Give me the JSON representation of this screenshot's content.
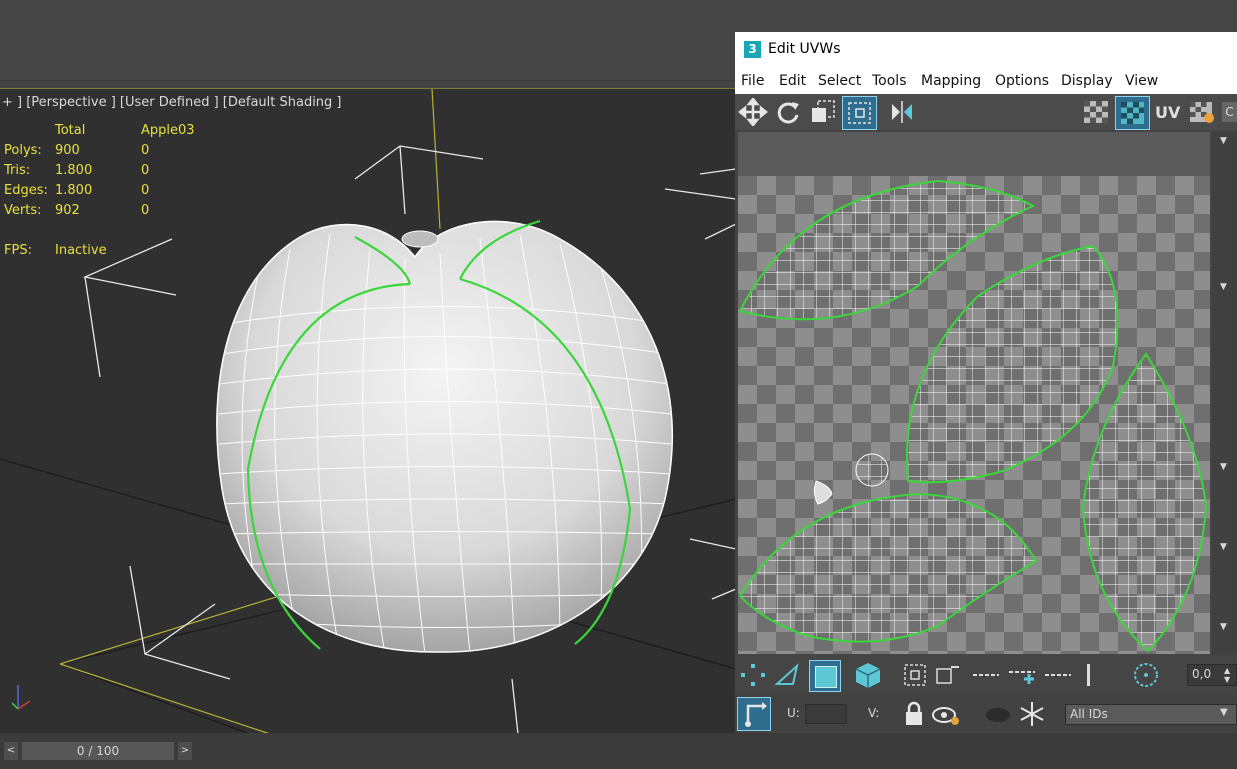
{
  "viewport": {
    "label": "+ ] [Perspective ] [User Defined ] [Default Shading ]",
    "stats": {
      "col_total": "Total",
      "col_object": "Apple03",
      "rows": [
        {
          "name": "Polys:",
          "total": "900",
          "object": "0"
        },
        {
          "name": "Tris:",
          "total": "1.800",
          "object": "0"
        },
        {
          "name": "Edges:",
          "total": "1.800",
          "object": "0"
        },
        {
          "name": "Verts:",
          "total": "902",
          "object": "0"
        }
      ],
      "fps_label": "FPS:",
      "fps_value": "Inactive"
    }
  },
  "uvw_window": {
    "title": "Edit UVWs",
    "app_icon_text": "3",
    "menu": [
      "File",
      "Edit",
      "Select",
      "Tools",
      "Mapping",
      "Options",
      "Display",
      "View"
    ],
    "toolbar_uv_label": "UV",
    "toolbar_cut_label": "C",
    "u_label": "U:",
    "v_label": "V:",
    "spinner_value": "0,0",
    "ids_dropdown": "All IDs"
  },
  "timeline": {
    "frame": "0 / 100",
    "prev": "<",
    "next": ">"
  },
  "colors": {
    "viewport_bg": "#303030",
    "stat_text": "#e8e040",
    "seam": "#3ad63a",
    "uv_accent": "#5cc8d6"
  }
}
